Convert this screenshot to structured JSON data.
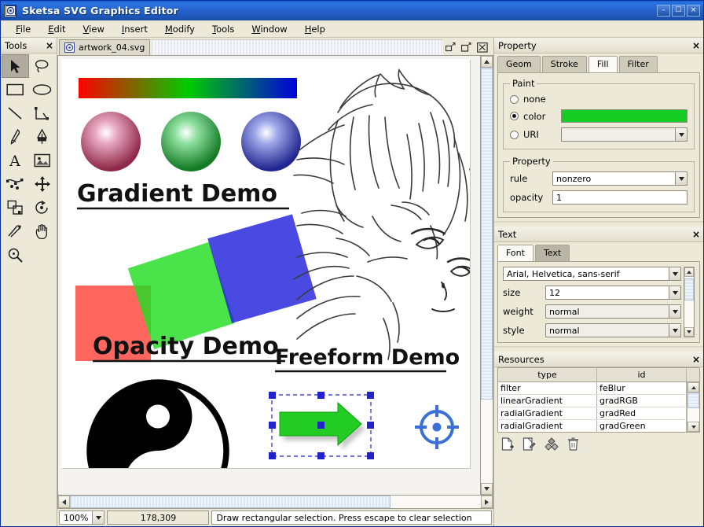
{
  "window": {
    "title": "Sketsa SVG Graphics Editor",
    "icon": "app-logo-icon",
    "controls": [
      {
        "name": "minimize-button",
        "glyph": "–"
      },
      {
        "name": "maximize-button",
        "glyph": "☐"
      },
      {
        "name": "close-button",
        "glyph": "×"
      }
    ]
  },
  "menubar": {
    "items": [
      "File",
      "Edit",
      "View",
      "Insert",
      "Modify",
      "Tools",
      "Window",
      "Help"
    ]
  },
  "tools": {
    "title": "Tools",
    "close_glyph": "×",
    "items": [
      {
        "name": "select-arrow-tool",
        "label": "Select",
        "active": true
      },
      {
        "name": "lasso-tool",
        "label": "Lasso",
        "active": false
      },
      {
        "name": "rectangle-tool",
        "label": "Rectangle",
        "active": false
      },
      {
        "name": "ellipse-tool",
        "label": "Ellipse",
        "active": false
      },
      {
        "name": "line-tool",
        "label": "Line",
        "active": false
      },
      {
        "name": "polyline-tool",
        "label": "Polyline",
        "active": false
      },
      {
        "name": "pencil-tool",
        "label": "Pencil",
        "active": false
      },
      {
        "name": "pen-tool",
        "label": "Pen",
        "active": false
      },
      {
        "name": "text-tool",
        "label": "Text",
        "active": false
      },
      {
        "name": "image-tool",
        "label": "Image",
        "active": false
      },
      {
        "name": "node-edit-tool",
        "label": "Edit Nodes",
        "active": false
      },
      {
        "name": "move-tool",
        "label": "Move",
        "active": false
      },
      {
        "name": "duplicate-tool",
        "label": "Duplicate",
        "active": false
      },
      {
        "name": "rotate-tool",
        "label": "Rotate",
        "active": false
      },
      {
        "name": "skew-tool",
        "label": "Skew",
        "active": false
      },
      {
        "name": "hand-tool",
        "label": "Pan",
        "active": false
      },
      {
        "name": "zoom-tool",
        "label": "Zoom",
        "active": false
      }
    ]
  },
  "document": {
    "tab_label": "artwork_04.svg",
    "tab_icon": "svg-document-icon",
    "controls": [
      {
        "name": "restore-document-button",
        "glyph": "restore"
      },
      {
        "name": "maximize-document-button",
        "glyph": "maximize"
      },
      {
        "name": "close-document-button",
        "glyph": "close"
      }
    ]
  },
  "canvas": {
    "labels": {
      "gradient_demo": "Gradient Demo",
      "opacity_demo": "Opacity Demo",
      "freeform_demo": "Freeform Demo"
    },
    "colors": {
      "gradient_bar_stops": [
        "#ff0000",
        "#00cc00",
        "#0000dd"
      ],
      "sphere_red": "#a03050",
      "sphere_green": "#1f8a30",
      "sphere_blue": "#2a2f9e",
      "square_red": "#ff3b30",
      "square_green": "#22dd22",
      "square_blue": "#2222dd",
      "arrow_green": "#22cc22",
      "selection_handle": "#2222cc",
      "target_marker": "#3a6fd8"
    }
  },
  "statusbar": {
    "zoom": "100%",
    "zoom_arrow_icon": "chevron-down-icon",
    "coordinates": "178,309",
    "message": "Draw rectangular selection. Press escape to clear selection"
  },
  "property_panel": {
    "title": "Property",
    "close_glyph": "×",
    "tabs": [
      {
        "label": "Geom",
        "active": false
      },
      {
        "label": "Stroke",
        "active": false
      },
      {
        "label": "Fill",
        "active": true
      },
      {
        "label": "Filter",
        "active": false
      }
    ],
    "paint": {
      "legend": "Paint",
      "options": [
        {
          "label": "none",
          "selected": false
        },
        {
          "label": "color",
          "selected": true
        },
        {
          "label": "URI",
          "selected": false
        }
      ],
      "color_value": "#15cc22",
      "uri_value": ""
    },
    "property": {
      "legend": "Property",
      "rule_label": "rule",
      "rule_value": "nonzero",
      "opacity_label": "opacity",
      "opacity_value": "1"
    }
  },
  "text_panel": {
    "title": "Text",
    "close_glyph": "×",
    "tabs": [
      {
        "label": "Font",
        "active": true
      },
      {
        "label": "Text",
        "active": false
      }
    ],
    "font": {
      "family_value": "Arial, Helvetica, sans-serif",
      "size_label": "size",
      "size_value": "12",
      "weight_label": "weight",
      "weight_value": "normal",
      "style_label": "style",
      "style_value": "normal"
    }
  },
  "resources_panel": {
    "title": "Resources",
    "close_glyph": "×",
    "columns": [
      "type",
      "id"
    ],
    "rows": [
      {
        "type": "filter",
        "id": "feBlur"
      },
      {
        "type": "linearGradient",
        "id": "gradRGB"
      },
      {
        "type": "radialGradient",
        "id": "gradRed"
      },
      {
        "type": "radialGradient",
        "id": "gradGreen"
      }
    ],
    "toolbar": [
      {
        "name": "new-resource-button",
        "label": "New"
      },
      {
        "name": "edit-resource-button",
        "label": "Edit"
      },
      {
        "name": "apply-resource-button",
        "label": "Apply"
      },
      {
        "name": "delete-resource-button",
        "label": "Delete"
      }
    ]
  }
}
